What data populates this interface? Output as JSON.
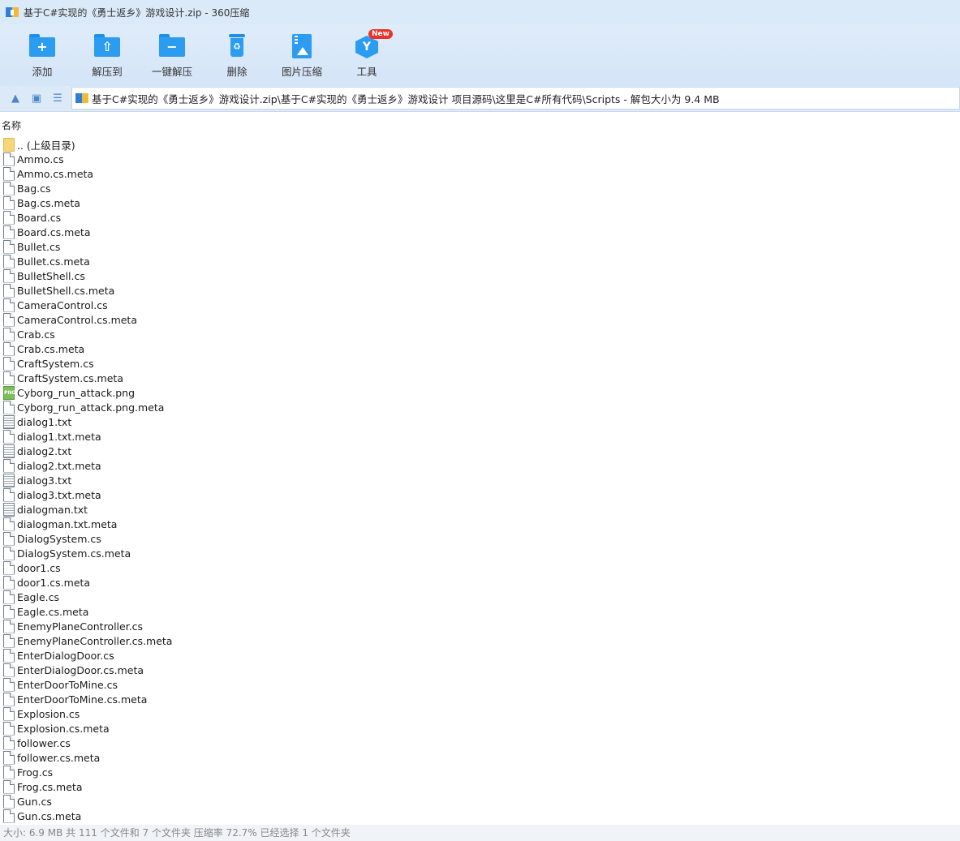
{
  "window": {
    "title": "基于C#实现的《勇士返乡》游戏设计.zip - 360压缩"
  },
  "toolbar": {
    "items": [
      {
        "label": "添加",
        "icon": "folder-add-icon"
      },
      {
        "label": "解压到",
        "icon": "folder-extract-icon"
      },
      {
        "label": "一键解压",
        "icon": "folder-oneclick-icon"
      },
      {
        "label": "删除",
        "icon": "trash-icon"
      },
      {
        "label": "图片压缩",
        "icon": "image-compress-icon"
      },
      {
        "label": "工具",
        "icon": "tools-icon",
        "badge": "New"
      }
    ]
  },
  "addressbar": {
    "path": "基于C#实现的《勇士返乡》游戏设计.zip\\基于C#实现的《勇士返乡》游戏设计 项目源码\\这里是C#所有代码\\Scripts - 解包大小为 9.4 MB"
  },
  "list": {
    "column_name": "名称",
    "files": [
      {
        "name": ".. (上级目录)",
        "type": "folder"
      },
      {
        "name": "Ammo.cs",
        "type": "file"
      },
      {
        "name": "Ammo.cs.meta",
        "type": "file"
      },
      {
        "name": "Bag.cs",
        "type": "file"
      },
      {
        "name": "Bag.cs.meta",
        "type": "file"
      },
      {
        "name": "Board.cs",
        "type": "file"
      },
      {
        "name": "Board.cs.meta",
        "type": "file"
      },
      {
        "name": "Bullet.cs",
        "type": "file"
      },
      {
        "name": "Bullet.cs.meta",
        "type": "file"
      },
      {
        "name": "BulletShell.cs",
        "type": "file"
      },
      {
        "name": "BulletShell.cs.meta",
        "type": "file"
      },
      {
        "name": "CameraControl.cs",
        "type": "file"
      },
      {
        "name": "CameraControl.cs.meta",
        "type": "file"
      },
      {
        "name": "Crab.cs",
        "type": "file"
      },
      {
        "name": "Crab.cs.meta",
        "type": "file"
      },
      {
        "name": "CraftSystem.cs",
        "type": "file"
      },
      {
        "name": "CraftSystem.cs.meta",
        "type": "file"
      },
      {
        "name": "Cyborg_run_attack.png",
        "type": "png"
      },
      {
        "name": "Cyborg_run_attack.png.meta",
        "type": "file"
      },
      {
        "name": "dialog1.txt",
        "type": "txt"
      },
      {
        "name": "dialog1.txt.meta",
        "type": "file"
      },
      {
        "name": "dialog2.txt",
        "type": "txt"
      },
      {
        "name": "dialog2.txt.meta",
        "type": "file"
      },
      {
        "name": "dialog3.txt",
        "type": "txt"
      },
      {
        "name": "dialog3.txt.meta",
        "type": "file"
      },
      {
        "name": "dialogman.txt",
        "type": "txt"
      },
      {
        "name": "dialogman.txt.meta",
        "type": "file"
      },
      {
        "name": "DialogSystem.cs",
        "type": "file"
      },
      {
        "name": "DialogSystem.cs.meta",
        "type": "file"
      },
      {
        "name": "door1.cs",
        "type": "file"
      },
      {
        "name": "door1.cs.meta",
        "type": "file"
      },
      {
        "name": "Eagle.cs",
        "type": "file"
      },
      {
        "name": "Eagle.cs.meta",
        "type": "file"
      },
      {
        "name": "EnemyPlaneController.cs",
        "type": "file"
      },
      {
        "name": "EnemyPlaneController.cs.meta",
        "type": "file"
      },
      {
        "name": "EnterDialogDoor.cs",
        "type": "file"
      },
      {
        "name": "EnterDialogDoor.cs.meta",
        "type": "file"
      },
      {
        "name": "EnterDoorToMine.cs",
        "type": "file"
      },
      {
        "name": "EnterDoorToMine.cs.meta",
        "type": "file"
      },
      {
        "name": "Explosion.cs",
        "type": "file"
      },
      {
        "name": "Explosion.cs.meta",
        "type": "file"
      },
      {
        "name": "follower.cs",
        "type": "file"
      },
      {
        "name": "follower.cs.meta",
        "type": "file"
      },
      {
        "name": "Frog.cs",
        "type": "file"
      },
      {
        "name": "Frog.cs.meta",
        "type": "file"
      },
      {
        "name": "Gun.cs",
        "type": "file"
      },
      {
        "name": "Gun.cs.meta",
        "type": "file"
      }
    ]
  },
  "statusbar": {
    "text": "大小: 6.9 MB 共 111 个文件和 7 个文件夹 压缩率 72.7% 已经选择 1 个文件夹"
  },
  "colors": {
    "accent": "#2b9cf0",
    "titlebar": "#dbeaf8",
    "badge": "#e8332a"
  }
}
